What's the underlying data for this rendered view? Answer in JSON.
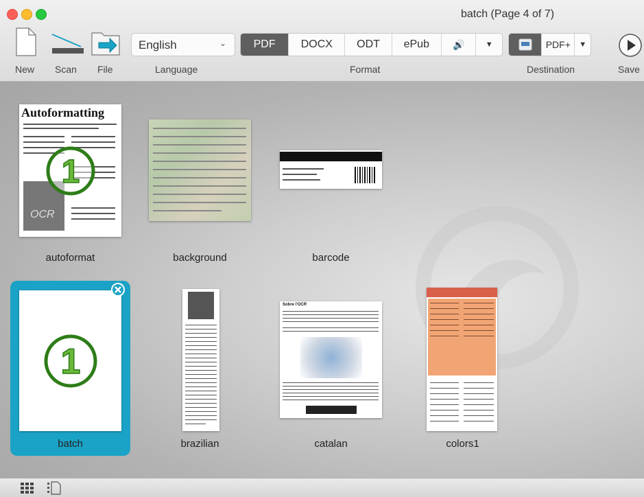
{
  "window": {
    "title": "batch (Page 4 of 7)"
  },
  "toolbar": {
    "new_label": "New",
    "scan_label": "Scan",
    "file_label": "File",
    "language_value": "English",
    "language_label": "Language",
    "format_options": [
      "PDF",
      "DOCX",
      "ODT",
      "ePub"
    ],
    "format_active": "PDF",
    "format_label": "Format",
    "destination_value": "PDF+",
    "destination_label": "Destination",
    "save_label": "Save"
  },
  "documents": [
    {
      "name": "autoformat",
      "heading": "Autoformatting",
      "stamp": "OCR"
    },
    {
      "name": "background"
    },
    {
      "name": "barcode"
    },
    {
      "name": "batch",
      "selected": true
    },
    {
      "name": "brazilian"
    },
    {
      "name": "catalan",
      "heading": "Sobre l'OCR"
    },
    {
      "name": "colors1"
    }
  ],
  "colors": {
    "selection": "#1aa3c6",
    "active_segment": "#5f5f5f",
    "badge_green": "#2e7d18"
  }
}
